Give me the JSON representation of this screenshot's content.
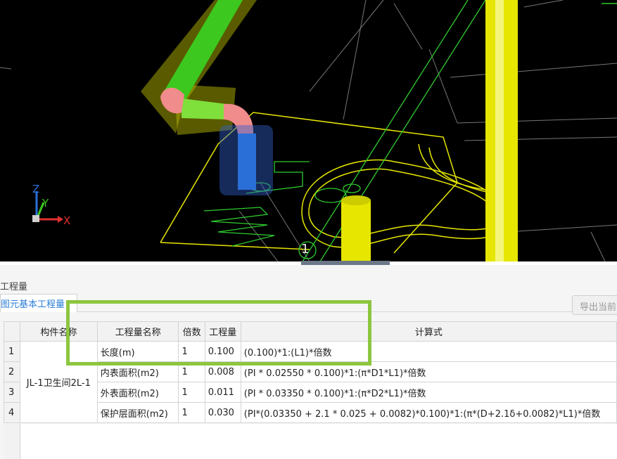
{
  "viewport": {
    "axis_z": "Z",
    "axis_y": "Y",
    "axis_x": "X",
    "view_number": "1",
    "colors": {
      "background": "#000000",
      "pipe_green": "#3cc81e",
      "pipe_blue": "#2a6fd8",
      "elbow_pink": "#f08c8c",
      "yellow": "#e6e600"
    }
  },
  "panel": {
    "title": "工程量",
    "tab_label": "图元基本工程量",
    "export_label": "导出当前"
  },
  "table": {
    "headers": [
      "",
      "构件名称",
      "工程量名称",
      "倍数",
      "工程量",
      "计算式"
    ],
    "component_name": "JL-1卫生间2L-1",
    "rows": [
      {
        "index": "1",
        "name": "长度(m)",
        "multiplier": "1",
        "quantity": "0.100",
        "formula": "(0.100)*1:(L1)*倍数"
      },
      {
        "index": "2",
        "name": "内表面积(m2)",
        "multiplier": "1",
        "quantity": "0.008",
        "formula": "(PI * 0.02550 * 0.100)*1:(π*D1*L1)*倍数"
      },
      {
        "index": "3",
        "name": "外表面积(m2)",
        "multiplier": "1",
        "quantity": "0.011",
        "formula": "(PI * 0.03350 * 0.100)*1:(π*D2*L1)*倍数"
      },
      {
        "index": "4",
        "name": "保护层面积(m2)",
        "multiplier": "1",
        "quantity": "0.030",
        "formula": "(PI*(0.03350 + 2.1 * 0.025 + 0.0082)*0.100)*1:(π*(D+2.1δ+0.0082)*L1)*倍数"
      }
    ]
  },
  "highlight_color": "#8cc63f"
}
